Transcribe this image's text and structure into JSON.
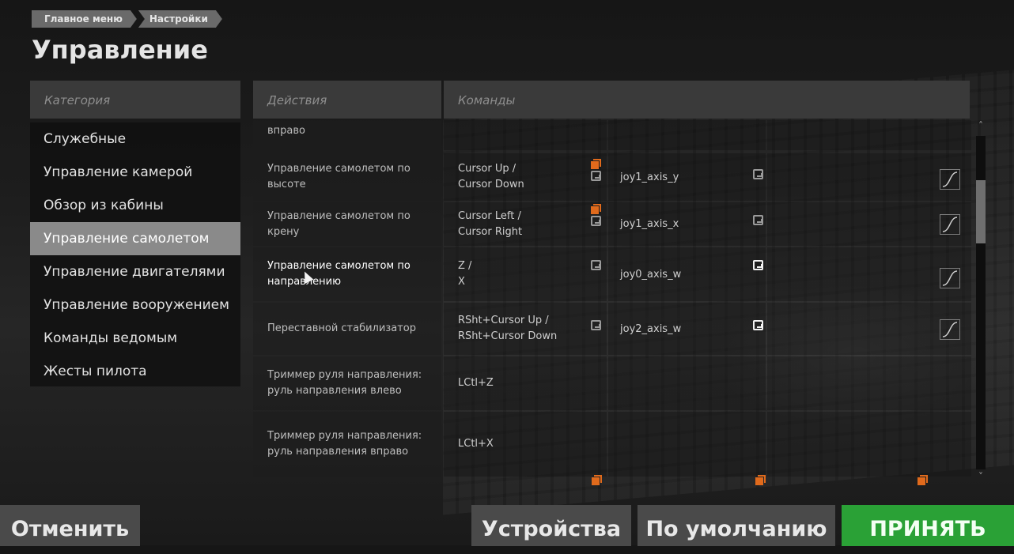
{
  "breadcrumb": [
    "Главное меню",
    "Настройки"
  ],
  "title": "Управление",
  "headers": {
    "category": "Категория",
    "actions": "Действия",
    "commands": "Команды"
  },
  "categories": [
    "Служебные",
    "Управление камерой",
    "Обзор из кабины",
    "Управление самолетом",
    "Управление двигателями",
    "Управление вооружением",
    "Команды ведомым",
    "Жесты пилота"
  ],
  "active_category": "Управление самолетом",
  "rows": [
    {
      "action": "вправо",
      "cmd1": "",
      "cmd2": "",
      "axis": ""
    },
    {
      "action": "Управление самолетом по высоте",
      "cmd1": "Cursor Up /",
      "cmd2": "Cursor Down",
      "axis": "joy1_axis_y"
    },
    {
      "action": "Управление самолетом по крену",
      "cmd1": "Cursor Left /",
      "cmd2": "Cursor Right",
      "axis": "joy1_axis_x"
    },
    {
      "action": "Управление самолетом по направлению",
      "cmd1": "Z /",
      "cmd2": "X",
      "axis": "joy0_axis_w"
    },
    {
      "action": "Переставной стабилизатор",
      "cmd1": "RSht+Cursor Up /",
      "cmd2": "RSht+Cursor Down",
      "axis": "joy2_axis_w"
    },
    {
      "action": "Триммер руля направления: руль направления влево",
      "cmd1": "LCtl+Z",
      "cmd2": "",
      "axis": ""
    },
    {
      "action": "Триммер руля направления: руль направления вправо",
      "cmd1": "LCtl+X",
      "cmd2": "",
      "axis": ""
    }
  ],
  "buttons": {
    "cancel": "Отменить",
    "devices": "Устройства",
    "defaults": "По умолчанию",
    "accept": "ПРИНЯТЬ"
  },
  "icons": {
    "device": "device-link-icon",
    "orange": "orange-copy-icon",
    "curve": "axis-curve-icon",
    "scroll_up": "chevron-up-icon",
    "scroll_down": "chevron-down-icon"
  },
  "colors": {
    "accent": "#2aa136",
    "highlight": "#e06a1c",
    "selected": "#8a8a8a"
  }
}
